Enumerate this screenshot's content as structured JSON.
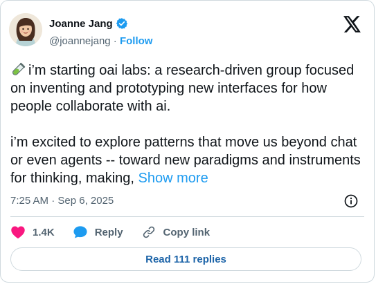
{
  "author": {
    "name": "Joanne Jang",
    "handle": "@joannejang",
    "separator": " · ",
    "follow_label": "Follow",
    "verified": true,
    "verified_color": "#1d9bf0"
  },
  "tweet": {
    "emoji": "test-tube-icon",
    "paragraph1": "i’m starting oai labs: a research-driven group focused on inventing and prototyping new interfaces for how people collaborate with ai.",
    "paragraph2": "i’m excited to explore patterns that move us beyond chat or even agents -- toward new paradigms and instruments for thinking, making,",
    "show_more_label": "Show more",
    "timestamp": "7:25 AM · Sep 6, 2025"
  },
  "actions": {
    "likes_count": "1.4K",
    "like_color": "#f91880",
    "reply_label": "Reply",
    "reply_color": "#1d9bf0",
    "copy_link_label": "Copy link"
  },
  "read_replies_label": "Read 111 replies",
  "colors": {
    "accent": "#1d9bf0",
    "text": "#0f1419",
    "muted": "#536471",
    "border": "#cfd9de"
  }
}
